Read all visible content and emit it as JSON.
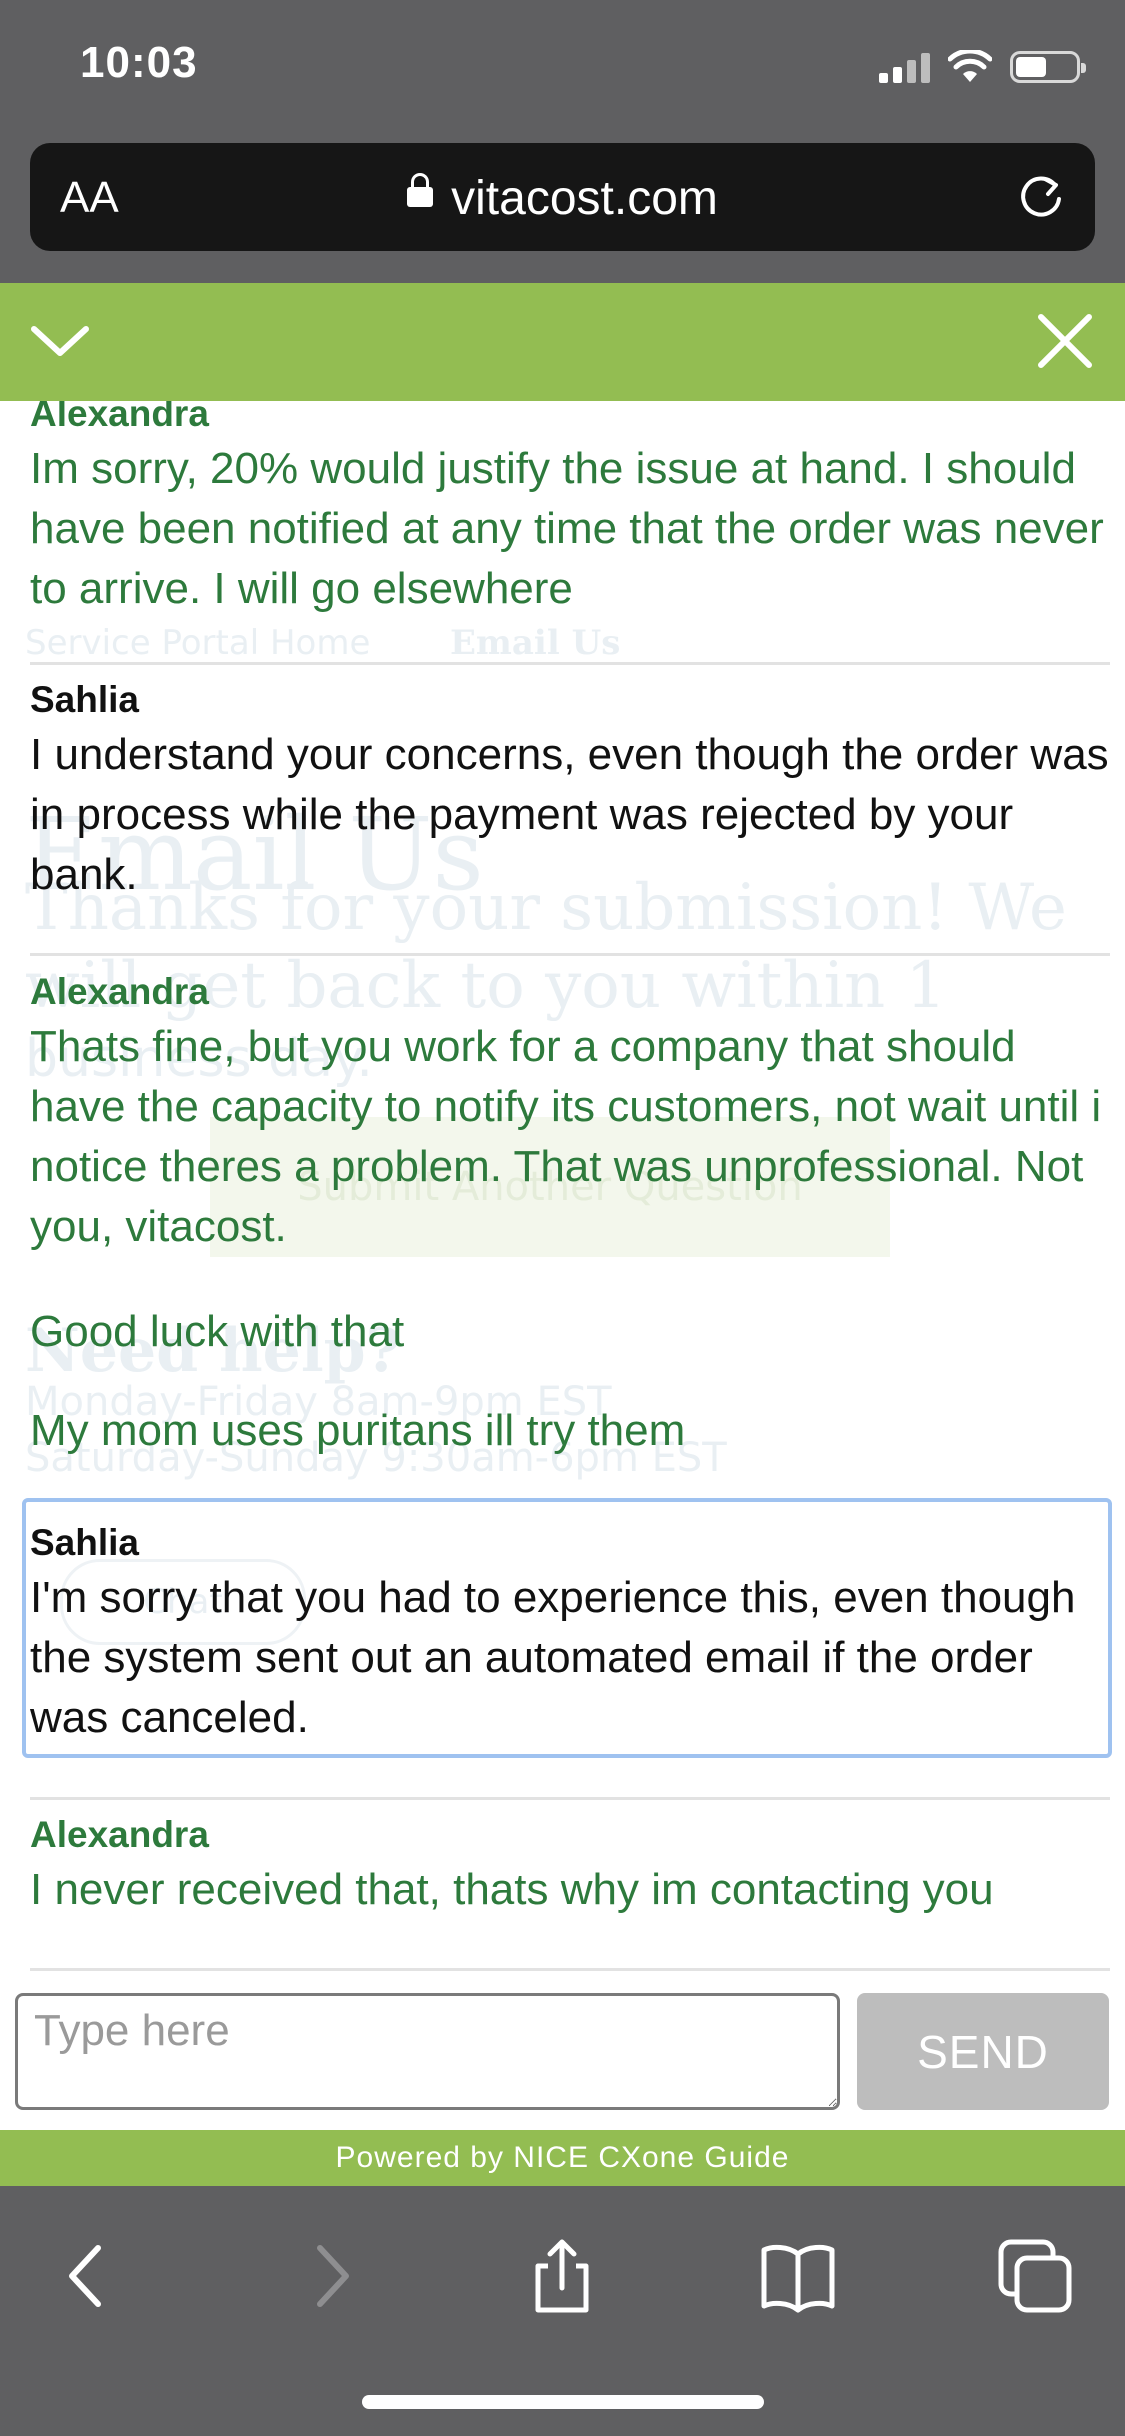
{
  "status": {
    "time": "10:03"
  },
  "browser": {
    "text_size_label": "AA",
    "url": "vitacost.com"
  },
  "chat": {
    "background_text": [
      "Service Portal Home",
      "Email Us",
      "Email Us",
      "Thanks for your submission! We",
      "will get back to you within 1",
      "business day.",
      "Submit Another Question",
      "Need help?",
      "Monday-Friday 8am-9pm EST",
      "Saturday-Sunday 9:30am-6pm EST",
      "Chat"
    ],
    "messages": [
      {
        "sender": "Alexandra",
        "text": "Im sorry, 20% would justify the issue at hand. I should have been notified at any time that the order was never to arrive. I will go elsewhere"
      },
      {
        "sender": "Sahlia",
        "text": "I understand your concerns, even though the order was in process while the payment was rejected by your bank."
      },
      {
        "sender": "Alexandra",
        "text": "Thats fine, but you work for a company that should have the capacity to notify its customers, not wait until i notice theres a problem. That was unprofessional. Not you, vitacost."
      },
      {
        "sender": "",
        "text": "Good luck with that"
      },
      {
        "sender": "",
        "text": "My mom uses puritans ill try them"
      },
      {
        "sender": "Sahlia",
        "text": "I'm sorry that you had to experience this, even though the system sent out an automated email if the order was canceled."
      },
      {
        "sender": "Alexandra",
        "text": "I never received that, thats why im contacting you"
      }
    ],
    "input": {
      "placeholder": "Type here",
      "value": ""
    },
    "send_label": "SEND",
    "powered_by": "Powered by NICE CXone Guide"
  },
  "colors": {
    "brand_green": "#93bd52",
    "customer_text": "#2d7a3c",
    "agent_text": "#111111",
    "focus_border": "#9fc2f0"
  }
}
